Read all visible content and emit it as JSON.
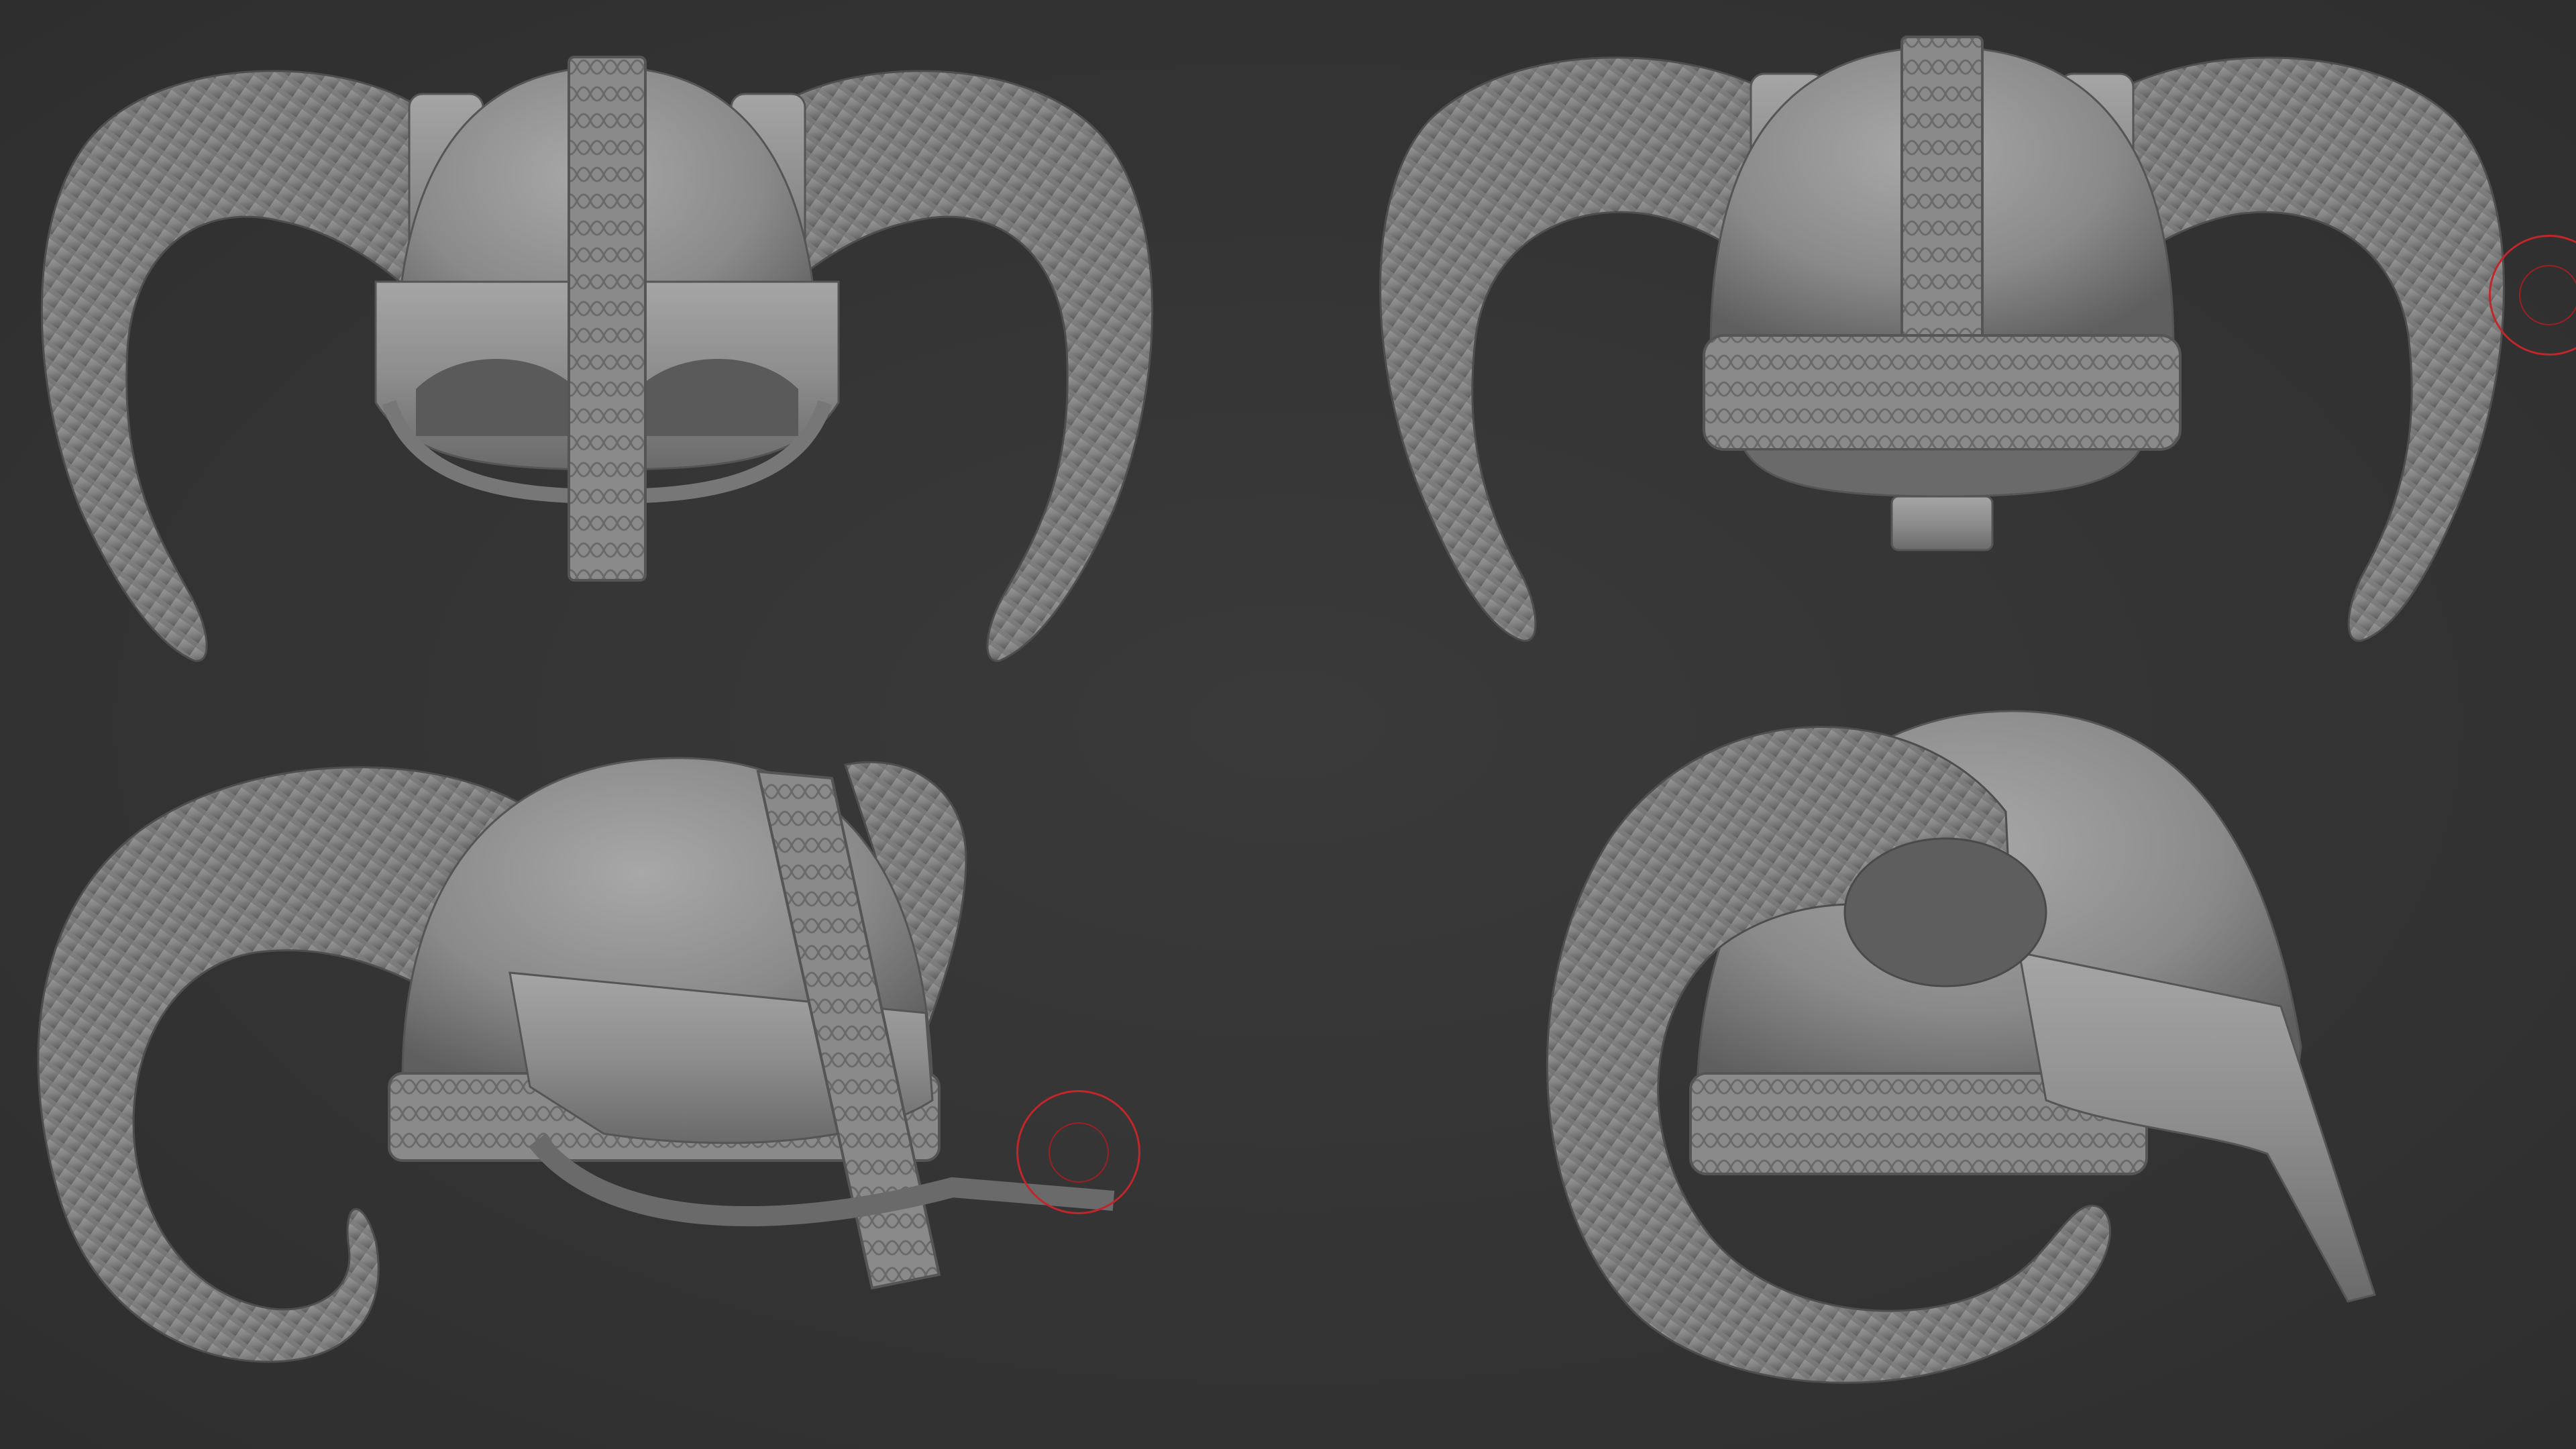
{
  "canvas": {
    "background_color": "#333333",
    "clay_color": "#8e8e8e"
  },
  "views": [
    {
      "id": "front",
      "view": "front"
    },
    {
      "id": "back",
      "view": "back"
    },
    {
      "id": "three-quarter",
      "view": "three-quarter"
    },
    {
      "id": "side",
      "view": "side"
    }
  ],
  "brush_cursors": [
    {
      "view": "back"
    },
    {
      "view": "three-quarter"
    }
  ],
  "brush_color": "#c0262a"
}
